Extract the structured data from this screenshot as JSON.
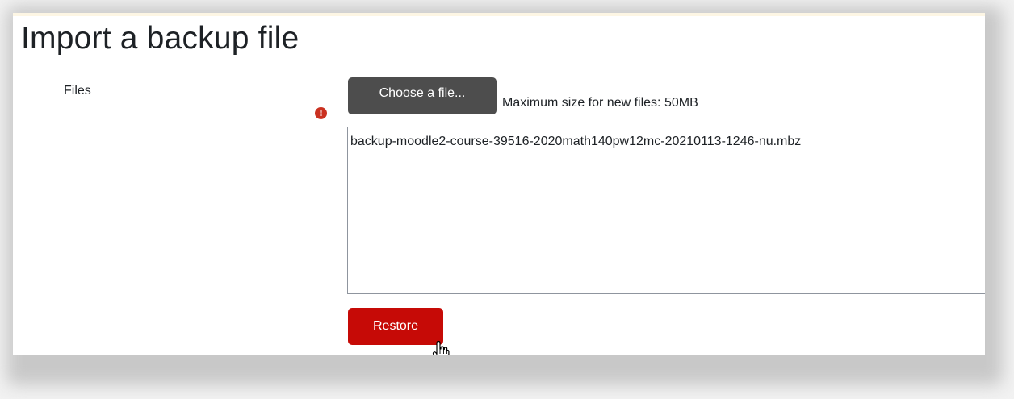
{
  "page": {
    "title": "Import a backup file"
  },
  "form": {
    "files_label": "Files",
    "required_icon": "exclamation-circle-icon",
    "choose_button_label": "Choose a file...",
    "max_size_text": "Maximum size for new files: 50MB",
    "selected_files": [
      "backup-moodle2-course-39516-2020math140pw12mc-20210113-1246-nu.mbz"
    ],
    "restore_button_label": "Restore"
  },
  "cursor": {
    "icon": "hand-pointer-icon"
  },
  "colors": {
    "choose_button_bg": "#4d4d4d",
    "restore_button_bg": "#c60a06",
    "required_icon": "#ca3120",
    "text": "#1d2125"
  }
}
